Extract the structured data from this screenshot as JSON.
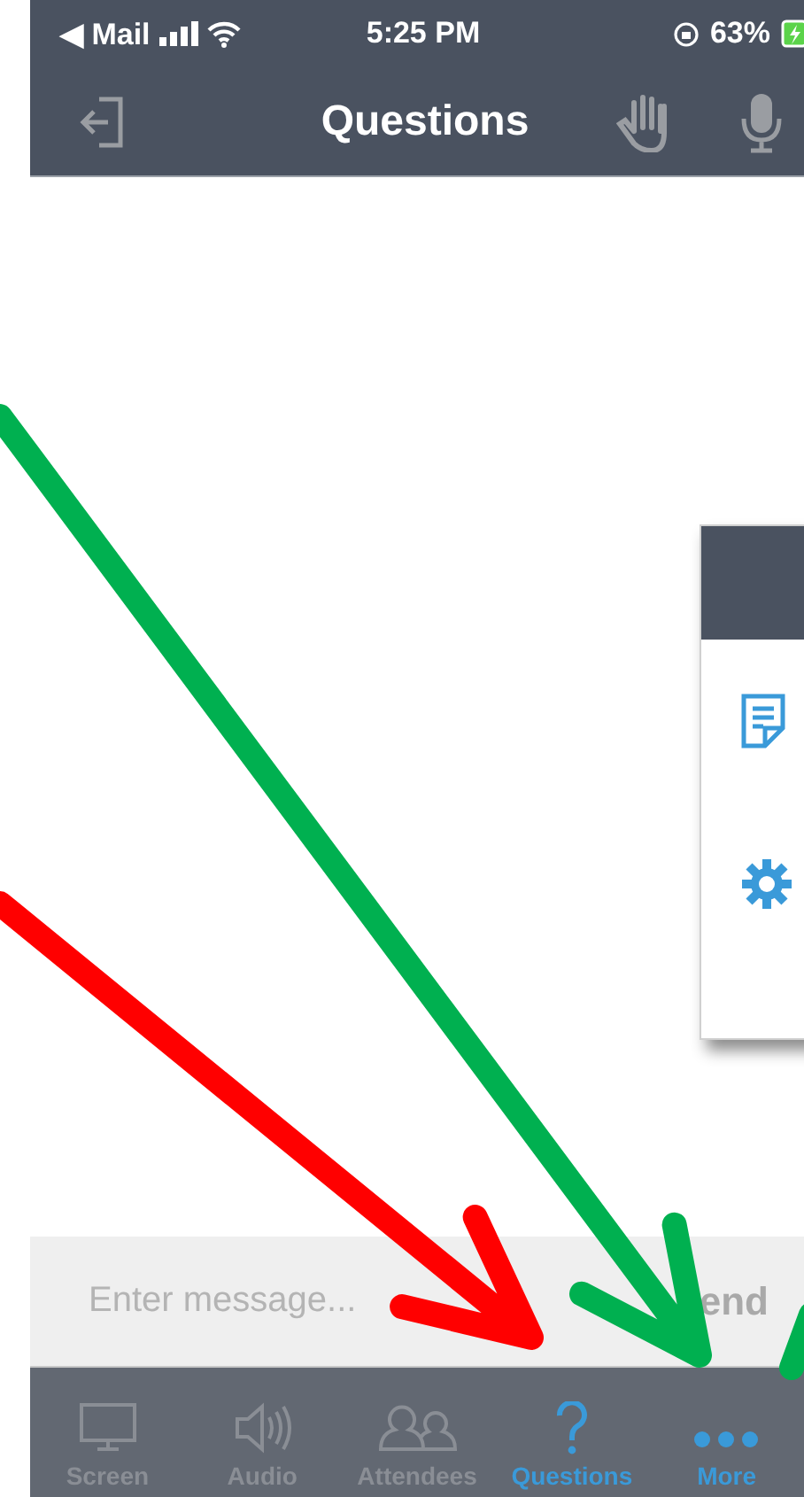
{
  "status_bar": {
    "back": "◀ Mail",
    "time": "5:25 PM",
    "battery": "63%"
  },
  "nav_bar": {
    "title": "Questions"
  },
  "popup_menu": {
    "items": [
      {
        "kind": "notes"
      },
      {
        "kind": "settings"
      }
    ]
  },
  "composer": {
    "placeholder": "Enter message...",
    "send": "end"
  },
  "tab_bar": [
    {
      "label": "Screen",
      "kind": "screen",
      "selected": false
    },
    {
      "label": "Audio",
      "kind": "audio",
      "selected": false
    },
    {
      "label": "Attendees",
      "kind": "attendees",
      "selected": false
    },
    {
      "label": "Questions",
      "kind": "questions",
      "selected": true
    },
    {
      "label": "More",
      "kind": "more",
      "selected": true
    }
  ],
  "annotations": [
    {
      "kind": "arrow",
      "color": "#00b050"
    },
    {
      "kind": "arrow",
      "color": "#ff0000"
    },
    {
      "kind": "arrow-stub",
      "color": "#00b050"
    }
  ]
}
